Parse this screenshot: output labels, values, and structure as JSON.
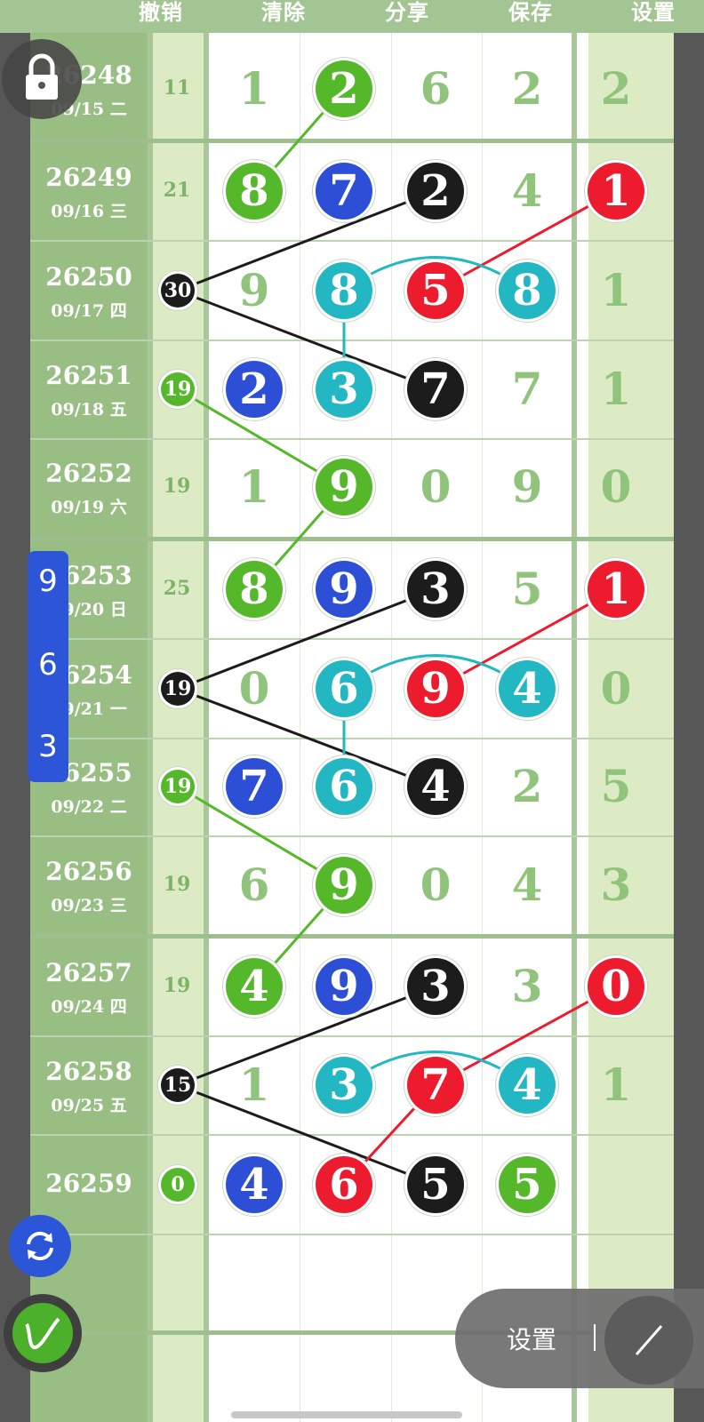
{
  "toolbar": {
    "undo_label": "撤销",
    "clear_label": "清除",
    "share_label": "分享",
    "save_label": "保存",
    "settings_label": "设置"
  },
  "side_panel": {
    "digits": [
      "9",
      "6",
      "3"
    ]
  },
  "bottom_panel": {
    "settings_label": "设置"
  },
  "colors": {
    "green": "#55b72a",
    "blue": "#2d4fd6",
    "black": "#1c1c1c",
    "red": "#ec1c2e",
    "cyan": "#22b7c2",
    "plain_digit": "#90c47c"
  },
  "rows": [
    {
      "issue": "26248",
      "date": "09/15 二",
      "sum": "11",
      "cells": [
        {
          "v": "1",
          "c": ""
        },
        {
          "v": "2",
          "c": "green"
        },
        {
          "v": "6",
          "c": ""
        },
        {
          "v": "2",
          "c": ""
        }
      ],
      "last": {
        "v": "2",
        "c": ""
      }
    },
    {
      "issue": "26249",
      "date": "09/16 三",
      "sum": "21",
      "cells": [
        {
          "v": "8",
          "c": "green"
        },
        {
          "v": "7",
          "c": "blue"
        },
        {
          "v": "2",
          "c": "black"
        },
        {
          "v": "4",
          "c": ""
        }
      ],
      "last": {
        "v": "1",
        "c": "red"
      }
    },
    {
      "issue": "26250",
      "date": "09/17 四",
      "sum": "30",
      "sum_color": "black",
      "cells": [
        {
          "v": "9",
          "c": ""
        },
        {
          "v": "8",
          "c": "cyan"
        },
        {
          "v": "5",
          "c": "red"
        },
        {
          "v": "8",
          "c": "cyan"
        }
      ],
      "last": {
        "v": "1",
        "c": ""
      }
    },
    {
      "issue": "26251",
      "date": "09/18 五",
      "sum": "19",
      "sum_color": "green",
      "cells": [
        {
          "v": "2",
          "c": "blue"
        },
        {
          "v": "3",
          "c": "cyan"
        },
        {
          "v": "7",
          "c": "black"
        },
        {
          "v": "7",
          "c": ""
        }
      ],
      "last": {
        "v": "1",
        "c": ""
      }
    },
    {
      "issue": "26252",
      "date": "09/19 六",
      "sum": "19",
      "cells": [
        {
          "v": "1",
          "c": ""
        },
        {
          "v": "9",
          "c": "green"
        },
        {
          "v": "0",
          "c": ""
        },
        {
          "v": "9",
          "c": ""
        }
      ],
      "last": {
        "v": "0",
        "c": ""
      }
    },
    {
      "issue": "26253",
      "date": "09/20 日",
      "sum": "25",
      "cells": [
        {
          "v": "8",
          "c": "green"
        },
        {
          "v": "9",
          "c": "blue"
        },
        {
          "v": "3",
          "c": "black"
        },
        {
          "v": "5",
          "c": ""
        }
      ],
      "last": {
        "v": "1",
        "c": "red"
      }
    },
    {
      "issue": "26254",
      "date": "09/21 一",
      "sum": "19",
      "sum_color": "black",
      "cells": [
        {
          "v": "0",
          "c": ""
        },
        {
          "v": "6",
          "c": "cyan"
        },
        {
          "v": "9",
          "c": "red"
        },
        {
          "v": "4",
          "c": "cyan"
        }
      ],
      "last": {
        "v": "0",
        "c": ""
      }
    },
    {
      "issue": "26255",
      "date": "09/22 二",
      "sum": "19",
      "sum_color": "green",
      "cells": [
        {
          "v": "7",
          "c": "blue"
        },
        {
          "v": "6",
          "c": "cyan"
        },
        {
          "v": "4",
          "c": "black"
        },
        {
          "v": "2",
          "c": ""
        }
      ],
      "last": {
        "v": "5",
        "c": ""
      }
    },
    {
      "issue": "26256",
      "date": "09/23 三",
      "sum": "19",
      "cells": [
        {
          "v": "6",
          "c": ""
        },
        {
          "v": "9",
          "c": "green"
        },
        {
          "v": "0",
          "c": ""
        },
        {
          "v": "4",
          "c": ""
        }
      ],
      "last": {
        "v": "3",
        "c": ""
      }
    },
    {
      "issue": "26257",
      "date": "09/24 四",
      "sum": "19",
      "cells": [
        {
          "v": "4",
          "c": "green"
        },
        {
          "v": "9",
          "c": "blue"
        },
        {
          "v": "3",
          "c": "black"
        },
        {
          "v": "3",
          "c": ""
        }
      ],
      "last": {
        "v": "0",
        "c": "red"
      }
    },
    {
      "issue": "26258",
      "date": "09/25 五",
      "sum": "15",
      "sum_color": "black",
      "cells": [
        {
          "v": "1",
          "c": ""
        },
        {
          "v": "3",
          "c": "cyan"
        },
        {
          "v": "7",
          "c": "red"
        },
        {
          "v": "4",
          "c": "cyan"
        }
      ],
      "last": {
        "v": "1",
        "c": ""
      }
    },
    {
      "issue": "26259",
      "date": "",
      "sum": "0",
      "sum_color": "green",
      "cells": [
        {
          "v": "4",
          "c": "blue"
        },
        {
          "v": "6",
          "c": "red"
        },
        {
          "v": "5",
          "c": "black"
        },
        {
          "v": "5",
          "c": "green"
        }
      ],
      "last": {
        "v": "",
        "c": ""
      }
    }
  ]
}
